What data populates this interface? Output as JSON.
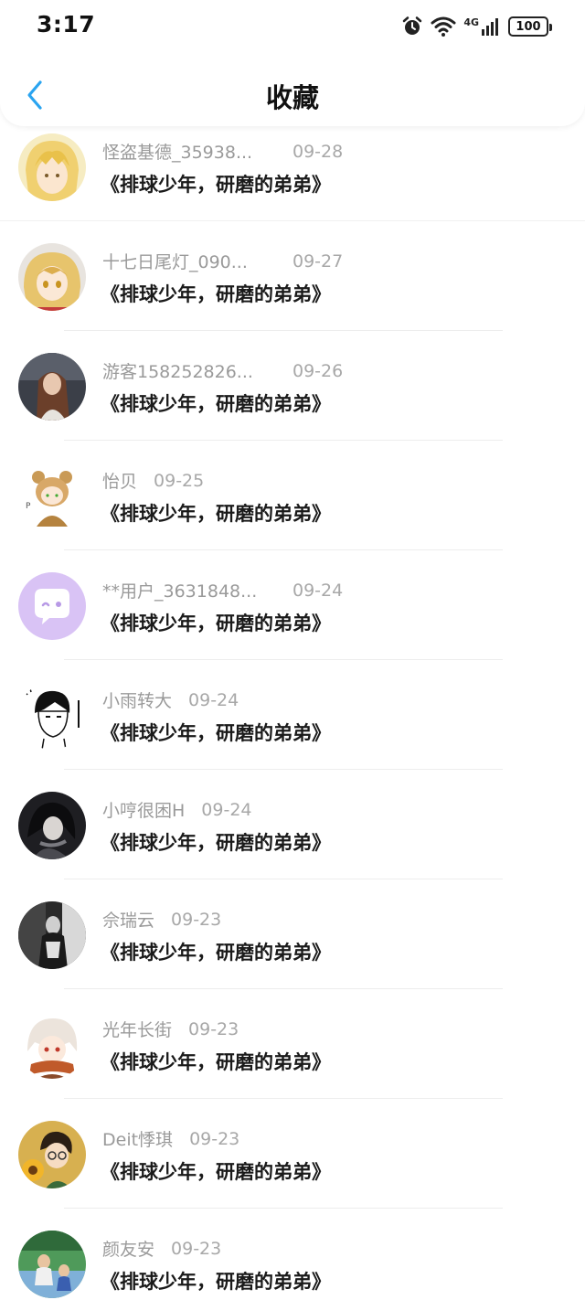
{
  "status": {
    "time": "3:17",
    "network": "4G",
    "battery": "100"
  },
  "header": {
    "title": "收藏",
    "back_icon": "chevron-left-icon",
    "accent": "#2aa4f0"
  },
  "items": [
    {
      "user": "怪盗基德_35938...",
      "date": "09-28",
      "book": "《排球少年，研磨的弟弟》",
      "avatar": "blonde-anime-avatar"
    },
    {
      "user": "十七日尾灯_090...",
      "date": "09-27",
      "book": "《排球少年，研磨的弟弟》",
      "avatar": "kenma-anime-avatar"
    },
    {
      "user": "游客158252826...",
      "date": "09-26",
      "book": "《排球少年，研磨的弟弟》",
      "avatar": "photo-girl-avatar"
    },
    {
      "user": "怡贝",
      "date": "09-25",
      "book": "《排球少年，研磨的弟弟》",
      "avatar": "bear-chibi-avatar"
    },
    {
      "user": "**用户_3631848...",
      "date": "09-24",
      "book": "《排球少年，研磨的弟弟》",
      "avatar": "chat-bubble-default-avatar"
    },
    {
      "user": "小雨转大",
      "date": "09-24",
      "book": "《排球少年，研磨的弟弟》",
      "avatar": "sketch-boy-avatar"
    },
    {
      "user": "小哼很困H",
      "date": "09-24",
      "book": "《排球少年，研磨的弟弟》",
      "avatar": "dark-anime-avatar"
    },
    {
      "user": "佘瑞云",
      "date": "09-23",
      "book": "《排球少年，研磨的弟弟》",
      "avatar": "bw-photo-avatar"
    },
    {
      "user": "光年长街",
      "date": "09-23",
      "book": "《排球少年，研磨的弟弟》",
      "avatar": "scarf-anime-avatar"
    },
    {
      "user": "Deit悸琪",
      "date": "09-23",
      "book": "《排球少年，研磨的弟弟》",
      "avatar": "sunflower-avatar"
    },
    {
      "user": "颜友安",
      "date": "09-23",
      "book": "《排球少年，研磨的弟弟》",
      "avatar": "kids-photo-avatar"
    }
  ]
}
